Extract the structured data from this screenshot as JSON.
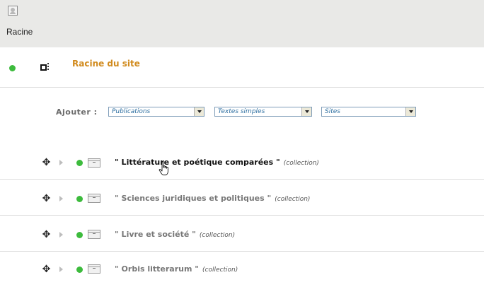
{
  "breadcrumb": {
    "root_label": "Racine",
    "root_icon": "root-page-icon"
  },
  "site": {
    "title": "Racine du site",
    "status_color": "#3dbb3d",
    "title_color": "#d18b1e"
  },
  "add_bar": {
    "label": "Ajouter :",
    "selects": [
      {
        "value": "Publications"
      },
      {
        "value": "Textes simples"
      },
      {
        "value": "Sites"
      }
    ]
  },
  "items": [
    {
      "title": "\" Littérature et poétique comparées \"",
      "type": "(collection)",
      "status": "published"
    },
    {
      "title": "\" Sciences juridiques et politiques \"",
      "type": "(collection)",
      "status": "published"
    },
    {
      "title": "\" Livre et société \"",
      "type": "(collection)",
      "status": "published"
    },
    {
      "title": "\" Orbis litterarum \"",
      "type": "(collection)",
      "status": "published"
    }
  ]
}
